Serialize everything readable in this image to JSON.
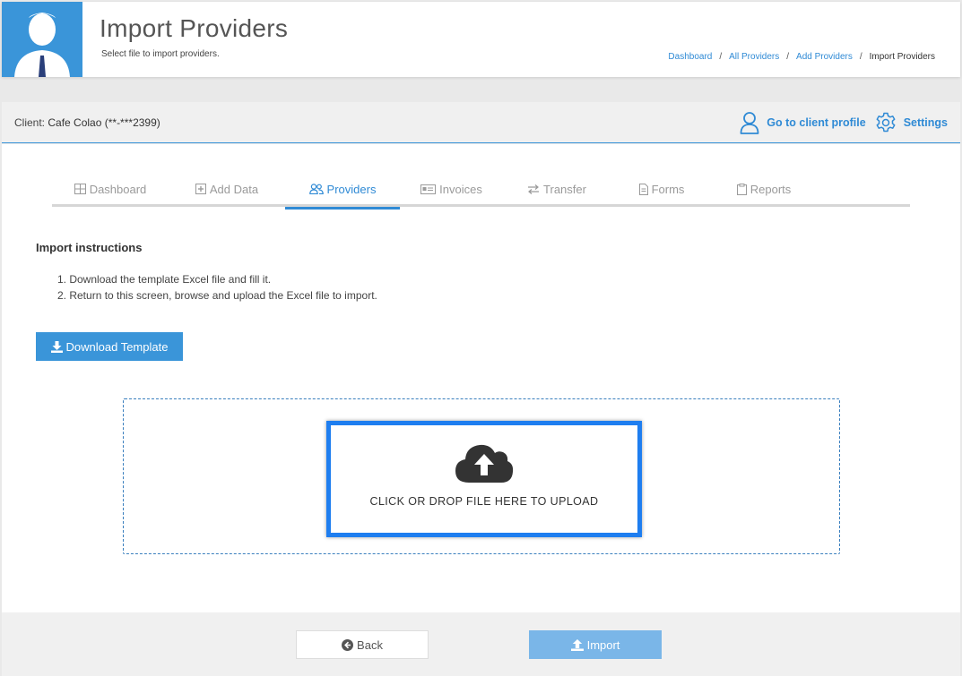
{
  "header": {
    "title": "Import Providers",
    "subtitle": "Select file to import providers.",
    "breadcrumb": [
      "Dashboard",
      "All Providers",
      "Add Providers",
      "Import Providers"
    ]
  },
  "client_bar": {
    "label": "Client:",
    "name": "Cafe Colao (**-***2399)",
    "profile_link": "Go to client profile",
    "settings_link": "Settings"
  },
  "tabs": [
    {
      "label": "Dashboard",
      "icon": "grid-icon"
    },
    {
      "label": "Add Data",
      "icon": "plus-square-icon"
    },
    {
      "label": "Providers",
      "icon": "users-icon",
      "active": true
    },
    {
      "label": "Invoices",
      "icon": "card-icon"
    },
    {
      "label": "Transfer",
      "icon": "exchange-icon"
    },
    {
      "label": "Forms",
      "icon": "document-icon"
    },
    {
      "label": "Reports",
      "icon": "clipboard-icon"
    }
  ],
  "instructions": {
    "title": "Import instructions",
    "steps": [
      "Download the template Excel file and fill it.",
      "Return to this screen, browse and upload the Excel file to import."
    ]
  },
  "download_button": "Download Template",
  "upload": {
    "text": "CLICK OR DROP FILE HERE TO UPLOAD"
  },
  "footer": {
    "back_label": "Back",
    "import_label": "Import"
  },
  "colors": {
    "accent": "#3a95d9",
    "link": "#2f8ad5",
    "upload_highlight": "#1e7ef0",
    "import_disabled": "#7ab6e8"
  }
}
